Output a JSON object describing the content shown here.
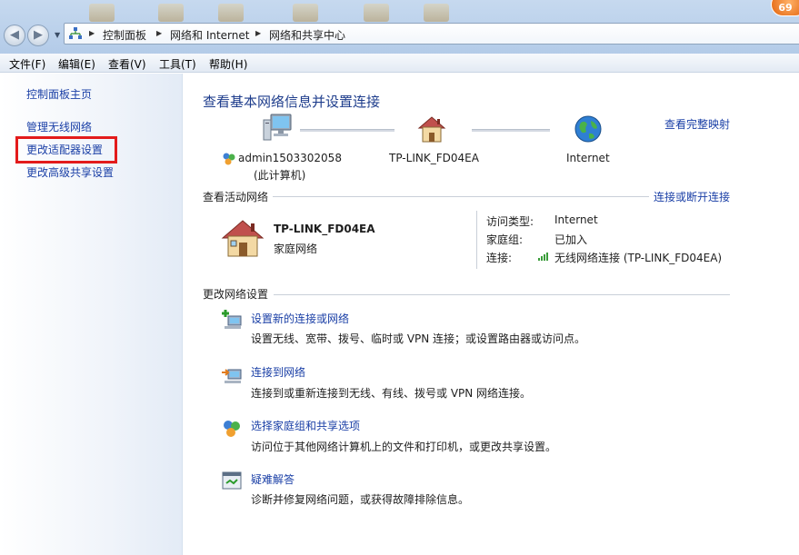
{
  "titlebar": {
    "badge": "69"
  },
  "address": {
    "crumbs": [
      "控制面板",
      "网络和 Internet",
      "网络和共享中心"
    ]
  },
  "menu": [
    "文件(F)",
    "编辑(E)",
    "查看(V)",
    "工具(T)",
    "帮助(H)"
  ],
  "sidebar": {
    "items": [
      "控制面板主页",
      "管理无线网络",
      "更改适配器设置",
      "更改高级共享设置"
    ]
  },
  "main": {
    "title": "查看基本网络信息并设置连接",
    "full_map_link": "查看完整映射",
    "nodes": {
      "computer_name": "admin1503302058",
      "computer_note": "(此计算机)",
      "router": "TP-LINK_FD04EA",
      "internet": "Internet"
    },
    "active": {
      "heading": "查看活动网络",
      "connect_link": "连接或断开连接",
      "network_name": "TP-LINK_FD04EA",
      "network_type": "家庭网络",
      "access_label": "访问类型:",
      "access_value": "Internet",
      "homegroup_label": "家庭组:",
      "homegroup_value": "已加入",
      "connection_label": "连接:",
      "connection_value": "无线网络连接 (TP-LINK_FD04EA)"
    },
    "change": {
      "heading": "更改网络设置",
      "tasks": [
        {
          "link": "设置新的连接或网络",
          "desc": "设置无线、宽带、拨号、临时或 VPN 连接；或设置路由器或访问点。"
        },
        {
          "link": "连接到网络",
          "desc": "连接到或重新连接到无线、有线、拨号或 VPN 网络连接。"
        },
        {
          "link": "选择家庭组和共享选项",
          "desc": "访问位于其他网络计算机上的文件和打印机，或更改共享设置。"
        },
        {
          "link": "疑难解答",
          "desc": "诊断并修复网络问题，或获得故障排除信息。"
        }
      ]
    }
  },
  "colors": {
    "link": "#1a3fa6",
    "title": "#1e3d8c",
    "highlight": "#e31b1b"
  }
}
